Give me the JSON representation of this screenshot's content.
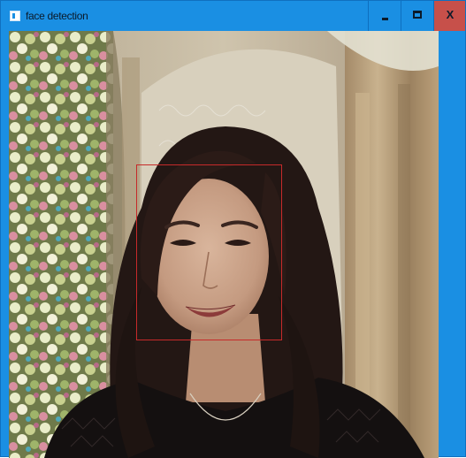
{
  "window": {
    "title": "face detection",
    "icon": "app-window-icon",
    "controls": {
      "minimize_icon": "minimize-icon",
      "maximize_icon": "maximize-icon",
      "close_label": "X"
    }
  },
  "colors": {
    "titlebar": "#1a8fe3",
    "close_button": "#c7504a",
    "detection_box": "#c62a2a"
  },
  "detections": [
    {
      "label": "face"
    }
  ]
}
